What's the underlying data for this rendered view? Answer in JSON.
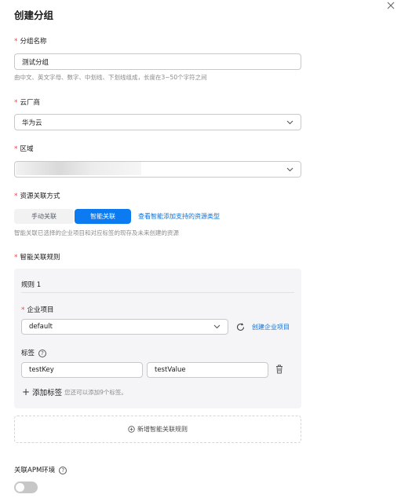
{
  "dialog": {
    "title": "创建分组"
  },
  "form": {
    "group_name": {
      "label": "分组名称",
      "value": "测试分组",
      "hint": "由中文、英文字母、数字、中划线、下划线组成，长度在3~50个字符之间"
    },
    "cloud_vendor": {
      "label": "云厂商",
      "value": "华为云"
    },
    "region": {
      "label": "区域",
      "value": ""
    },
    "association": {
      "label": "资源关联方式",
      "options": [
        "手动关联",
        "智能关联"
      ],
      "selected": "智能关联",
      "link": "查看智能添加支持的资源类型",
      "hint": "智能关联已选择的企业项目和对应标签的现存及未来创建的资源"
    },
    "smart_rules": {
      "label": "智能关联规则",
      "rule_title": "规则 1",
      "enterprise_project": {
        "label": "企业项目",
        "value": "default",
        "create_link": "创建企业项目"
      },
      "tags": {
        "label": "标签",
        "key": "testKey",
        "value": "testValue",
        "add_label": "添加标签",
        "add_hint": "您还可以添加9个标签。"
      },
      "add_rule": "新增智能关联规则"
    },
    "apm": {
      "label": "关联APM环境",
      "enabled": false
    }
  },
  "colors": {
    "accent": "#0c7bf2",
    "required": "#e84a4a",
    "link": "#0b6fd6"
  },
  "icons": [
    "close-icon",
    "chevron-down-icon",
    "refresh-icon",
    "trash-icon",
    "plus-icon",
    "add-circle-icon",
    "help-icon"
  ]
}
